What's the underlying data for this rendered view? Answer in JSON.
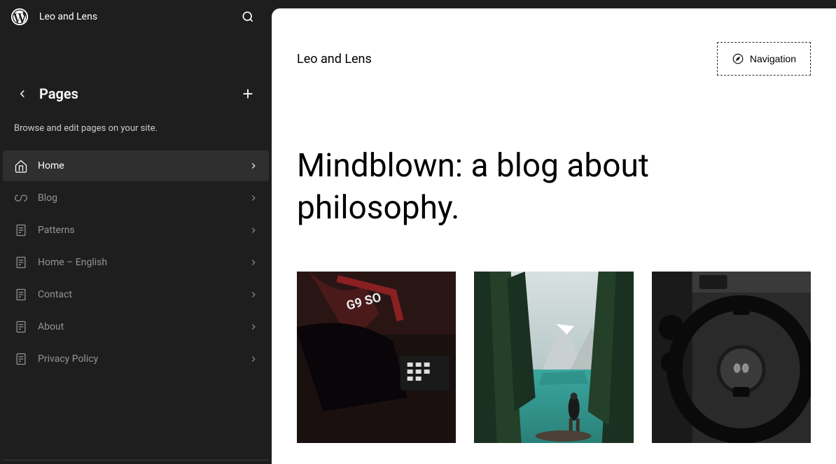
{
  "sidebar": {
    "site_title": "Leo and Lens",
    "section_title": "Pages",
    "description": "Browse and edit pages on your site.",
    "items": [
      {
        "label": "Home",
        "icon": "home",
        "active": true
      },
      {
        "label": "Blog",
        "icon": "loop",
        "active": false
      },
      {
        "label": "Patterns",
        "icon": "page",
        "active": false
      },
      {
        "label": "Home – English",
        "icon": "page",
        "active": false
      },
      {
        "label": "Contact",
        "icon": "page",
        "active": false
      },
      {
        "label": "About",
        "icon": "page",
        "active": false
      },
      {
        "label": "Privacy Policy",
        "icon": "page",
        "active": false
      }
    ]
  },
  "main": {
    "site_title": "Leo and Lens",
    "nav_button_label": "Navigation",
    "hero_title": "Mindblown: a blog about philosophy."
  }
}
